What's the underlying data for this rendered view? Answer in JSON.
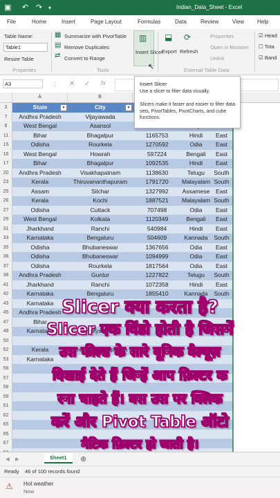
{
  "window": {
    "title": "Indian_Data_Sheet - Excel"
  },
  "ribbon_tabs": [
    "File",
    "Home",
    "Insert",
    "Page Layout",
    "Formulas",
    "Data",
    "Review",
    "View",
    "Help"
  ],
  "active_tab": "Table Design",
  "ribbon": {
    "table_name_label": "Table Name:",
    "table_name_value": "Table1",
    "resize_table": "Resize Table",
    "group_properties": "Properties",
    "summarize_pivot": "Summarize with PivotTable",
    "remove_duplicates": "Remove Duplicates",
    "convert_to_range": "Convert to Range",
    "group_tools": "Tools",
    "insert_slicer": "Insert Slicer",
    "export": "Export",
    "refresh": "Refresh",
    "properties": "Properties",
    "open_in_browser": "Open in Browser",
    "unlink": "Unlink",
    "group_external": "External Table Data",
    "opt_header": "Head",
    "opt_total": "Tota",
    "opt_banded": "Band"
  },
  "tooltip": {
    "title": "Insert Slicer",
    "line1": "Use a slicer to filter data visually.",
    "body": "Slicers make it faster and easier to filter data sets, PivotTables, PivotCharts, and cube functions."
  },
  "formula_bar": {
    "name_box": "A3"
  },
  "columns": [
    "A",
    "B",
    "C"
  ],
  "table": {
    "headers": [
      "State",
      "City"
    ],
    "rows": [
      {
        "n": "3",
        "c": [
          "State",
          "City",
          "",
          "",
          ""
        ]
      },
      {
        "n": "7",
        "c": [
          "Andhra Pradesh",
          "Vijayawada",
          "",
          "",
          ""
        ]
      },
      {
        "n": "8",
        "c": [
          "West Bengal",
          "Asansol",
          "1733788",
          "Bengali",
          "East"
        ]
      },
      {
        "n": "11",
        "c": [
          "Bihar",
          "Bhagalpur",
          "1165753",
          "Hindi",
          "East"
        ]
      },
      {
        "n": "15",
        "c": [
          "Odisha",
          "Rourkela",
          "1270592",
          "Odia",
          "East"
        ]
      },
      {
        "n": "16",
        "c": [
          "West Bengal",
          "Howrah",
          "597224",
          "Bengali",
          "East"
        ]
      },
      {
        "n": "17",
        "c": [
          "Bihar",
          "Bhagalpur",
          "1092535",
          "Hindi",
          "East"
        ]
      },
      {
        "n": "20",
        "c": [
          "Andhra Pradesh",
          "Visakhapatnam",
          "1138630",
          "Telugu",
          "South"
        ]
      },
      {
        "n": "23",
        "c": [
          "Kerala",
          "Thiruvananthapuram",
          "1791720",
          "Malayalam",
          "South"
        ]
      },
      {
        "n": "25",
        "c": [
          "Assam",
          "Silchar",
          "1327992",
          "Assamese",
          "East"
        ]
      },
      {
        "n": "26",
        "c": [
          "Kerala",
          "Kochi",
          "1887521",
          "Malayalam",
          "South"
        ]
      },
      {
        "n": "27",
        "c": [
          "Odisha",
          "Cuttack",
          "707498",
          "Odia",
          "East"
        ]
      },
      {
        "n": "29",
        "c": [
          "West Bengal",
          "Kolkata",
          "1120349",
          "Bengali",
          "East"
        ]
      },
      {
        "n": "31",
        "c": [
          "Jharkhand",
          "Ranchi",
          "540984",
          "Hindi",
          "East"
        ]
      },
      {
        "n": "33",
        "c": [
          "Karnataka",
          "Bengaluru",
          "504609",
          "Kannada",
          "South"
        ]
      },
      {
        "n": "35",
        "c": [
          "Odisha",
          "Bhubaneswar",
          "1367656",
          "Odia",
          "East"
        ]
      },
      {
        "n": "36",
        "c": [
          "Odisha",
          "Bhubaneswar",
          "1094999",
          "Odia",
          "East"
        ]
      },
      {
        "n": "37",
        "c": [
          "Odisha",
          "Rourkela",
          "1817564",
          "Odia",
          "East"
        ]
      },
      {
        "n": "38",
        "c": [
          "Andhra Pradesh",
          "Guntur",
          "1227822",
          "Telugu",
          "South"
        ]
      },
      {
        "n": "41",
        "c": [
          "Jharkhand",
          "Ranchi",
          "1072358",
          "Hindi",
          "East"
        ]
      },
      {
        "n": "42",
        "c": [
          "Karnataka",
          "Bengaluru",
          "1855410",
          "Kannada",
          "South"
        ]
      },
      {
        "n": "43",
        "c": [
          "Karnataka",
          "",
          "",
          "",
          ""
        ]
      },
      {
        "n": "45",
        "c": [
          "Andhra Pradesh",
          "",
          "",
          "",
          ""
        ]
      },
      {
        "n": "47",
        "c": [
          "Bihar",
          "",
          "",
          "",
          ""
        ]
      },
      {
        "n": "48",
        "c": [
          "Karnataka",
          "Mysore",
          "",
          "",
          ""
        ]
      },
      {
        "n": "50",
        "c": [
          "",
          "",
          "",
          "",
          ""
        ]
      },
      {
        "n": "52",
        "c": [
          "Kerala",
          "Thiruvananthapuram",
          "",
          "",
          ""
        ]
      },
      {
        "n": "53",
        "c": [
          "Karnataka",
          "",
          "",
          "",
          ""
        ]
      },
      {
        "n": "56",
        "c": [
          "",
          "",
          "",
          "",
          ""
        ]
      },
      {
        "n": "57",
        "c": [
          "",
          "",
          "",
          "",
          ""
        ]
      },
      {
        "n": "58",
        "c": [
          "",
          "",
          "",
          "",
          ""
        ]
      },
      {
        "n": "59",
        "c": [
          "",
          "",
          "",
          "",
          ""
        ]
      },
      {
        "n": "61",
        "c": [
          "",
          "",
          "",
          "",
          ""
        ]
      },
      {
        "n": "62",
        "c": [
          "",
          "",
          "",
          "",
          ""
        ]
      },
      {
        "n": "65",
        "c": [
          "",
          "",
          "",
          "",
          ""
        ]
      },
      {
        "n": "66",
        "c": [
          "",
          "",
          "",
          "",
          ""
        ]
      },
      {
        "n": "67",
        "c": [
          "",
          "",
          "",
          "",
          ""
        ]
      },
      {
        "n": "68",
        "c": [
          "",
          "",
          "",
          "",
          ""
        ]
      }
    ]
  },
  "overlay_text": [
    "Slicer क्या करता है?",
    "Slicer एक विंडो होती है जिसमें",
    "उस फील्ड के सारे यूनिक वैल्यूज़",
    "दिखाई देते हैं जिन्हें आप फ़िल्टर क",
    "रना चाहते हैं। बस उस पर क्लिक",
    "करें और Pivot Table ऑटो",
    "मैटिक फ़िल्टर हो जाती है।"
  ],
  "sheet_tab": "Sheet1",
  "status": {
    "ready": "Ready",
    "records": "46 of 100 records found"
  },
  "taskbar": {
    "weather_title": "Hot weather",
    "weather_sub": "Now"
  },
  "colors": {
    "excel_green": "#1e7145",
    "header_blue": "#5b87c7",
    "band_light": "#dbe4f1",
    "band_dark": "#b7c9e3",
    "overlay_stroke": "#a0006c"
  }
}
